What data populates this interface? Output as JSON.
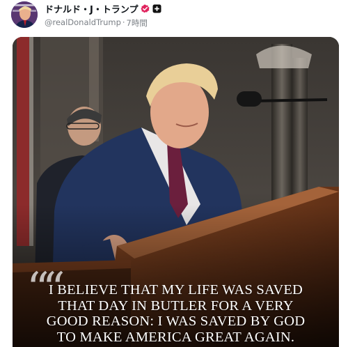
{
  "author": {
    "display_name": "ドナルド・J・トランプ",
    "handle": "@realDonaldTrump",
    "separator": "·",
    "timestamp": "7時間",
    "verified_badge": "verified-check-icon",
    "affiliation_badge": "square-logo-icon"
  },
  "media": {
    "quote_mark": "““",
    "quote_lines": [
      "I BELIEVE THAT MY LIFE WAS SAVED",
      "THAT DAY IN BUTLER FOR A VERY",
      "GOOD REASON: I WAS SAVED BY GOD",
      "TO MAKE AMERICA GREAT AGAIN."
    ]
  },
  "colors": {
    "verified_badge": "#e0245e",
    "text_primary": "#0f1419",
    "text_secondary": "#7a7f85"
  }
}
